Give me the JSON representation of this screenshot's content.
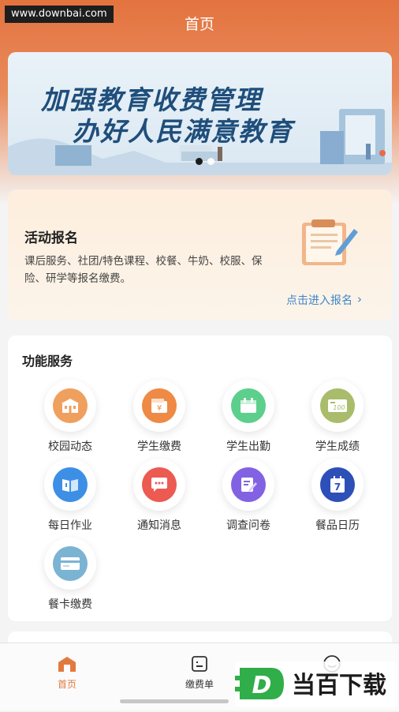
{
  "watermark": "www.downbai.com",
  "nav": {
    "title": "首页"
  },
  "banner": {
    "line1": "加强教育收费管理",
    "line2": "办好人民满意教育",
    "slide_count": 2,
    "active_slide": 1
  },
  "activity": {
    "title": "活动报名",
    "description": "课后服务、社团/特色课程、校餐、牛奶、校服、保险、研学等报名缴费。",
    "link": "点击进入报名"
  },
  "services": {
    "title": "功能服务",
    "items": [
      {
        "label": "校园动态",
        "icon": "school-building-icon",
        "color": "#f0a05e"
      },
      {
        "label": "学生缴费",
        "icon": "yuan-wallet-icon",
        "color": "#ee8a45"
      },
      {
        "label": "学生出勤",
        "icon": "calendar-icon",
        "color": "#5dcf8c"
      },
      {
        "label": "学生成绩",
        "icon": "score-card-icon",
        "color": "#a8bc6b"
      },
      {
        "label": "每日作业",
        "icon": "book-icon",
        "color": "#3d8fe6"
      },
      {
        "label": "通知消息",
        "icon": "message-bubble-icon",
        "color": "#ec5a52"
      },
      {
        "label": "调查问卷",
        "icon": "survey-edit-icon",
        "color": "#8262e3"
      },
      {
        "label": "餐品日历",
        "icon": "calendar-7-icon",
        "color": "#2d50b8"
      },
      {
        "label": "餐卡缴费",
        "icon": "card-icon",
        "color": "#7bb3d3"
      }
    ]
  },
  "tabbar": {
    "items": [
      {
        "label": "首页",
        "icon": "home-icon",
        "active": true
      },
      {
        "label": "缴费单",
        "icon": "bill-icon",
        "active": false
      },
      {
        "label": "",
        "icon": "profile-icon",
        "active": false
      }
    ],
    "active_color": "#e27a40"
  },
  "brand": {
    "letter": "D",
    "text": "当百下载"
  }
}
